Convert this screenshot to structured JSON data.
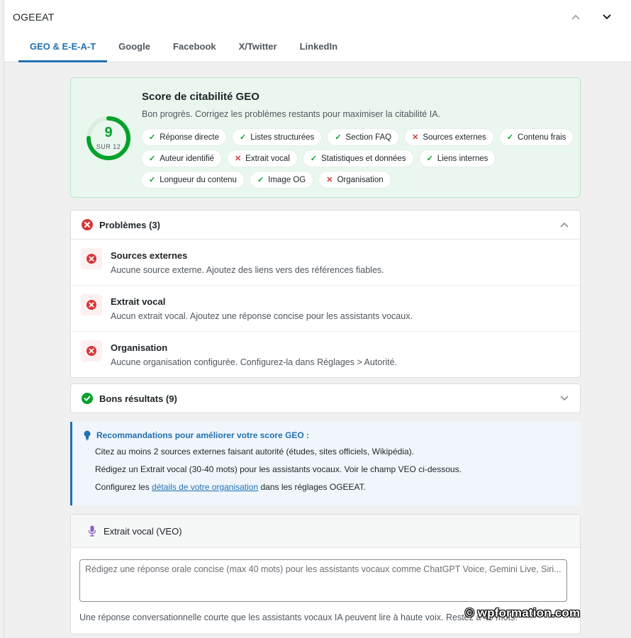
{
  "app": {
    "title": "OGEEAT"
  },
  "tabs": [
    {
      "label": "GEO & E-E-A-T",
      "active": true
    },
    {
      "label": "Google"
    },
    {
      "label": "Facebook"
    },
    {
      "label": "X/Twitter"
    },
    {
      "label": "LinkedIn"
    }
  ],
  "score": {
    "title": "Score de citabilité GEO",
    "description": "Bon progrès. Corrigez les problèmes restants pour maximiser la citabilité IA.",
    "value": "9",
    "max_label": "SUR 12",
    "fraction": 0.75,
    "color": "#00a32a",
    "checks": [
      {
        "label": "Réponse directe",
        "status": "ok"
      },
      {
        "label": "Listes structurées",
        "status": "ok"
      },
      {
        "label": "Section FAQ",
        "status": "ok"
      },
      {
        "label": "Sources externes",
        "status": "ko"
      },
      {
        "label": "Contenu frais",
        "status": "ok"
      },
      {
        "label": "Auteur identifié",
        "status": "ok"
      },
      {
        "label": "Extrait vocal",
        "status": "ko"
      },
      {
        "label": "Statistiques et données",
        "status": "ok"
      },
      {
        "label": "Liens internes",
        "status": "ok"
      },
      {
        "label": "Longueur du contenu",
        "status": "ok"
      },
      {
        "label": "Image OG",
        "status": "ok"
      },
      {
        "label": "Organisation",
        "status": "ko"
      }
    ]
  },
  "problems": {
    "heading": "Problèmes (3)",
    "items": [
      {
        "title": "Sources externes",
        "description": "Aucune source externe. Ajoutez des liens vers des références fiables."
      },
      {
        "title": "Extrait vocal",
        "description": "Aucun extrait vocal. Ajoutez une réponse concise pour les assistants vocaux."
      },
      {
        "title": "Organisation",
        "description": "Aucune organisation configurée. Configurez-la dans Réglages > Autorité."
      }
    ]
  },
  "good": {
    "heading": "Bons résultats (9)"
  },
  "recommendations": {
    "title": "Recommandations pour améliorer votre score GEO :",
    "item1": "Citez au moins 2 sources externes faisant autorité (études, sites officiels, Wikipédia).",
    "item2": "Rédigez un Extrait vocal (30-40 mots) pour les assistants vocaux. Voir le champ VEO ci-dessous.",
    "item3_before": "Configurez les ",
    "item3_link": "détails de votre organisation",
    "item3_after": " dans les réglages OGEEAT."
  },
  "veo": {
    "heading": "Extrait vocal (VEO)",
    "placeholder": "Rédigez une réponse orale concise (max 40 mots) pour les assistants vocaux comme ChatGPT Voice, Gemini Live, Siri...",
    "value": "",
    "help": "Une réponse conversationnelle courte que les assistants vocaux IA peuvent lire à haute voix. Restez à 40 mots."
  },
  "watermark": "© wpformation.com",
  "colors": {
    "accent": "#2271b1",
    "success": "#00a32a",
    "error": "#d63638",
    "mic": "#8c5fbf"
  },
  "icons": {
    "collapse_panel": "chevron-up-icon",
    "toggle_panel": "chevron-down-icon",
    "problems": "error-circle-icon",
    "good": "check-circle-icon",
    "recommendations": "lightbulb-icon",
    "veo": "microphone-icon"
  }
}
